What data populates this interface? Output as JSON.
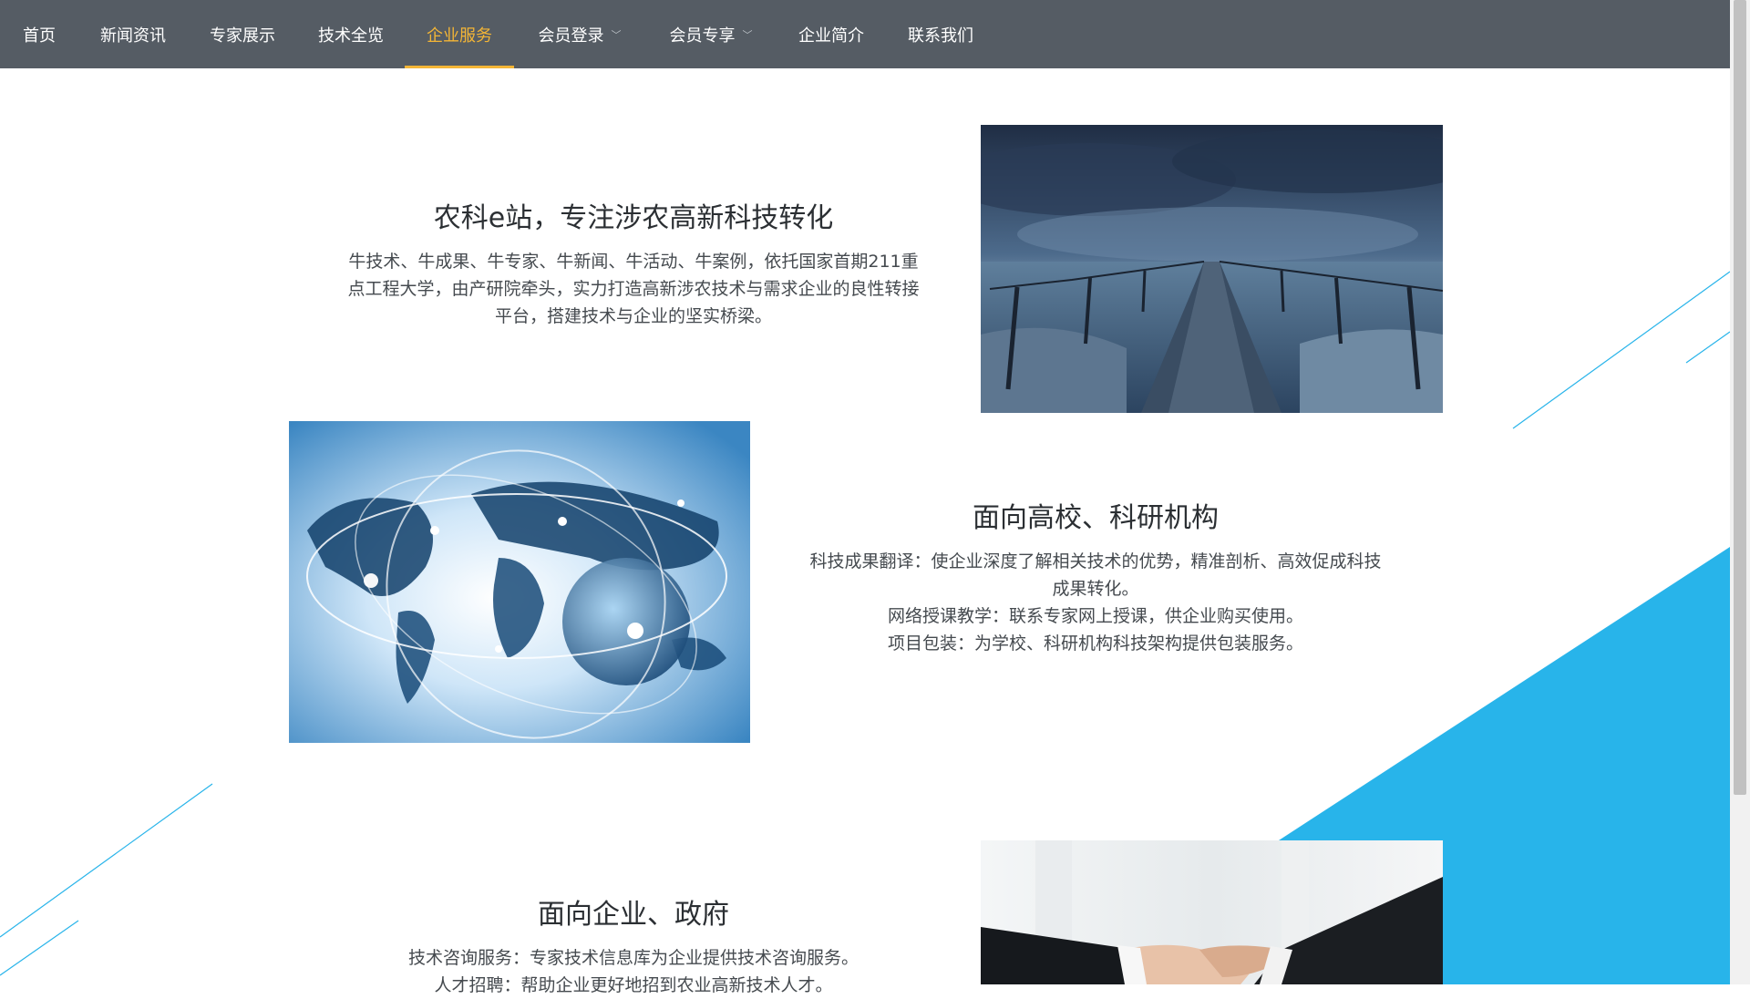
{
  "nav": {
    "items": [
      {
        "label": "首页"
      },
      {
        "label": "新闻资讯"
      },
      {
        "label": "专家展示"
      },
      {
        "label": "技术全览"
      },
      {
        "label": "企业服务",
        "active": true
      },
      {
        "label": "会员登录",
        "dropdown": true
      },
      {
        "label": "会员专享",
        "dropdown": true
      },
      {
        "label": "企业简介"
      },
      {
        "label": "联系我们"
      }
    ]
  },
  "sections": {
    "intro": {
      "title": "农科e站，专注涉农高新科技转化",
      "desc": "牛技术、牛成果、牛专家、牛新闻、牛活动、牛案例，依托国家首期211重点工程大学，由产研院牵头，实力打造高新涉农技术与需求企业的良性转接平台，搭建技术与企业的坚实桥梁。",
      "image": "pier-bridge-image"
    },
    "universities": {
      "title": "面向高校、科研机构",
      "lines": [
        "科技成果翻译：使企业深度了解相关技术的优势，精准剖析、高效促成科技成果转化。",
        "网络授课教学：联系专家网上授课，供企业购买使用。",
        "项目包装：为学校、科研机构科技架构提供包装服务。"
      ],
      "image": "world-network-globe-image"
    },
    "enterprises": {
      "title": "面向企业、政府",
      "lines": [
        "技术咨询服务：专家技术信息库为企业提供技术咨询服务。",
        "人才招聘：帮助企业更好地招到农业高新技术人才。"
      ],
      "image": "handshake-image"
    }
  },
  "colors": {
    "nav_bg": "#555c64",
    "nav_active": "#f3b536",
    "accent_blue": "#28b4ea"
  }
}
